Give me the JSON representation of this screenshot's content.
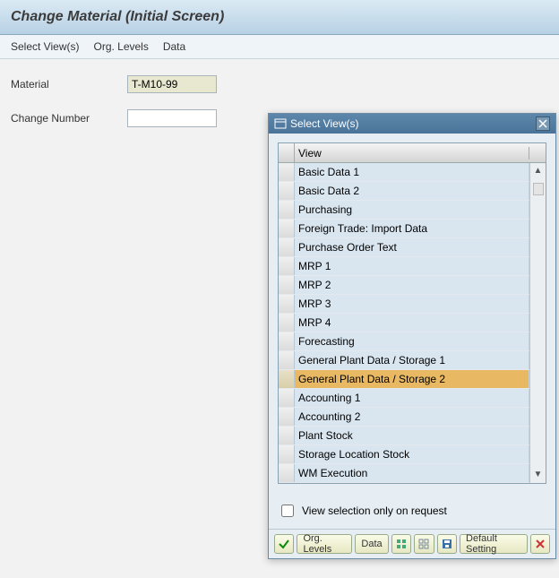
{
  "title": "Change Material (Initial Screen)",
  "menu": {
    "select_views": "Select View(s)",
    "org_levels": "Org. Levels",
    "data": "Data"
  },
  "form": {
    "material_label": "Material",
    "material_value": "T-M10-99",
    "change_number_label": "Change Number",
    "change_number_value": ""
  },
  "dialog": {
    "title": "Select View(s)",
    "column_header": "View",
    "rows": [
      {
        "label": "Basic Data 1",
        "selected": false
      },
      {
        "label": "Basic Data 2",
        "selected": false
      },
      {
        "label": "Purchasing",
        "selected": false
      },
      {
        "label": "Foreign Trade: Import Data",
        "selected": false
      },
      {
        "label": "Purchase Order Text",
        "selected": false
      },
      {
        "label": "MRP 1",
        "selected": false
      },
      {
        "label": "MRP 2",
        "selected": false
      },
      {
        "label": "MRP 3",
        "selected": false
      },
      {
        "label": "MRP 4",
        "selected": false
      },
      {
        "label": "Forecasting",
        "selected": false
      },
      {
        "label": "General Plant Data / Storage 1",
        "selected": false
      },
      {
        "label": "General Plant Data / Storage 2",
        "selected": true
      },
      {
        "label": "Accounting 1",
        "selected": false
      },
      {
        "label": "Accounting 2",
        "selected": false
      },
      {
        "label": "Plant Stock",
        "selected": false
      },
      {
        "label": "Storage Location Stock",
        "selected": false
      },
      {
        "label": "WM Execution",
        "selected": false
      }
    ],
    "checkbox_label": "View selection only on request",
    "checkbox_checked": false,
    "footer": {
      "ok_icon": "check-icon",
      "org_levels": "Org. Levels",
      "data": "Data",
      "select_all_icon": "select-all-icon",
      "deselect_all_icon": "deselect-all-icon",
      "save_icon": "save-icon",
      "default_setting": "Default Setting",
      "cancel_icon": "cancel-icon"
    }
  }
}
